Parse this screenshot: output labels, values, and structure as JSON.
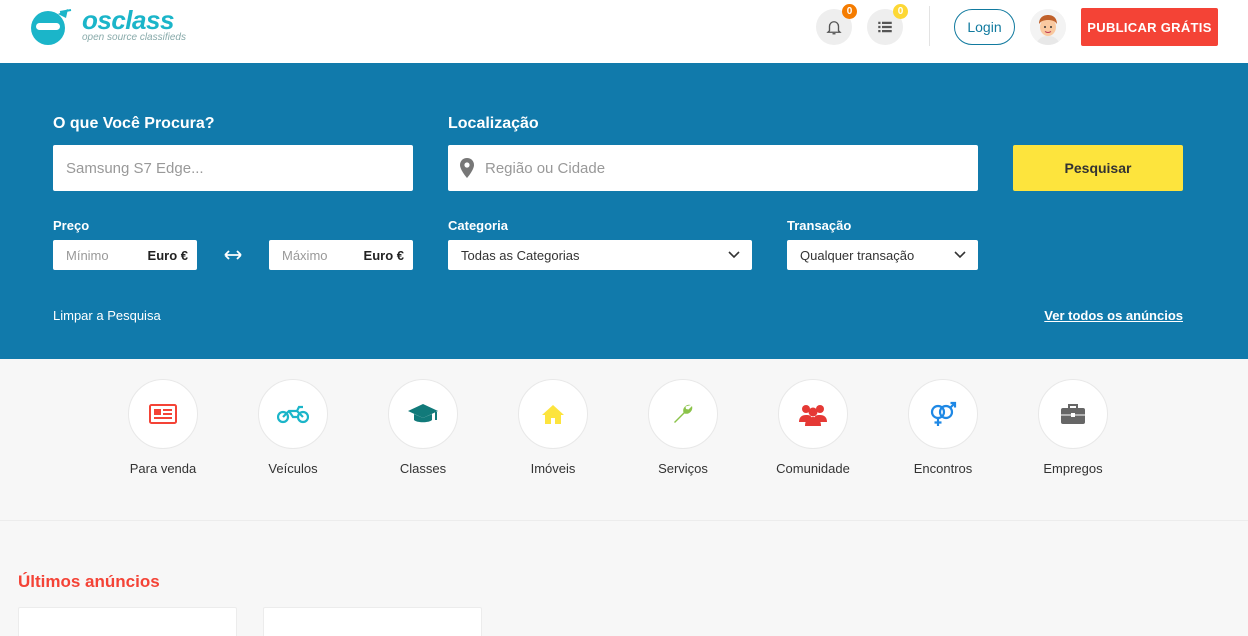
{
  "header": {
    "logo_text": "osclass",
    "logo_tagline": "open source classifieds",
    "notifications_count": "0",
    "messages_count": "0",
    "login_label": "Login",
    "publish_label": "PUBLICAR GRÁTIS"
  },
  "search": {
    "what_label": "O que Você Procura?",
    "what_placeholder": "Samsung S7 Edge...",
    "location_label": "Localização",
    "location_placeholder": "Região ou Cidade",
    "search_button": "Pesquisar",
    "price_label": "Preço",
    "price_min_placeholder": "Mínimo",
    "price_max_placeholder": "Máximo",
    "currency": "Euro €",
    "category_label": "Categoria",
    "category_selected": "Todas as Categorias",
    "transaction_label": "Transação",
    "transaction_selected": "Qualquer transação",
    "clear_link": "Limpar a Pesquisa",
    "view_all_link": "Ver todos os anúncios"
  },
  "categories": [
    {
      "label": "Para venda",
      "icon": "newspaper-icon",
      "color": "#f44336"
    },
    {
      "label": "Veículos",
      "icon": "motorcycle-icon",
      "color": "#1bb5c9"
    },
    {
      "label": "Classes",
      "icon": "graduation-cap-icon",
      "color": "#117a7a"
    },
    {
      "label": "Imóveis",
      "icon": "home-icon",
      "color": "#fde43d"
    },
    {
      "label": "Serviços",
      "icon": "wrench-icon",
      "color": "#8bc34a"
    },
    {
      "label": "Comunidade",
      "icon": "users-icon",
      "color": "#e53935"
    },
    {
      "label": "Encontros",
      "icon": "gender-icon",
      "color": "#1e88e5"
    },
    {
      "label": "Empregos",
      "icon": "briefcase-icon",
      "color": "#666666"
    }
  ],
  "latest": {
    "title": "Últimos anúncios"
  },
  "colors": {
    "brand": "#1bb5c9",
    "search_band": "#117aab",
    "accent_red": "#f44336",
    "search_button": "#fde43d"
  }
}
